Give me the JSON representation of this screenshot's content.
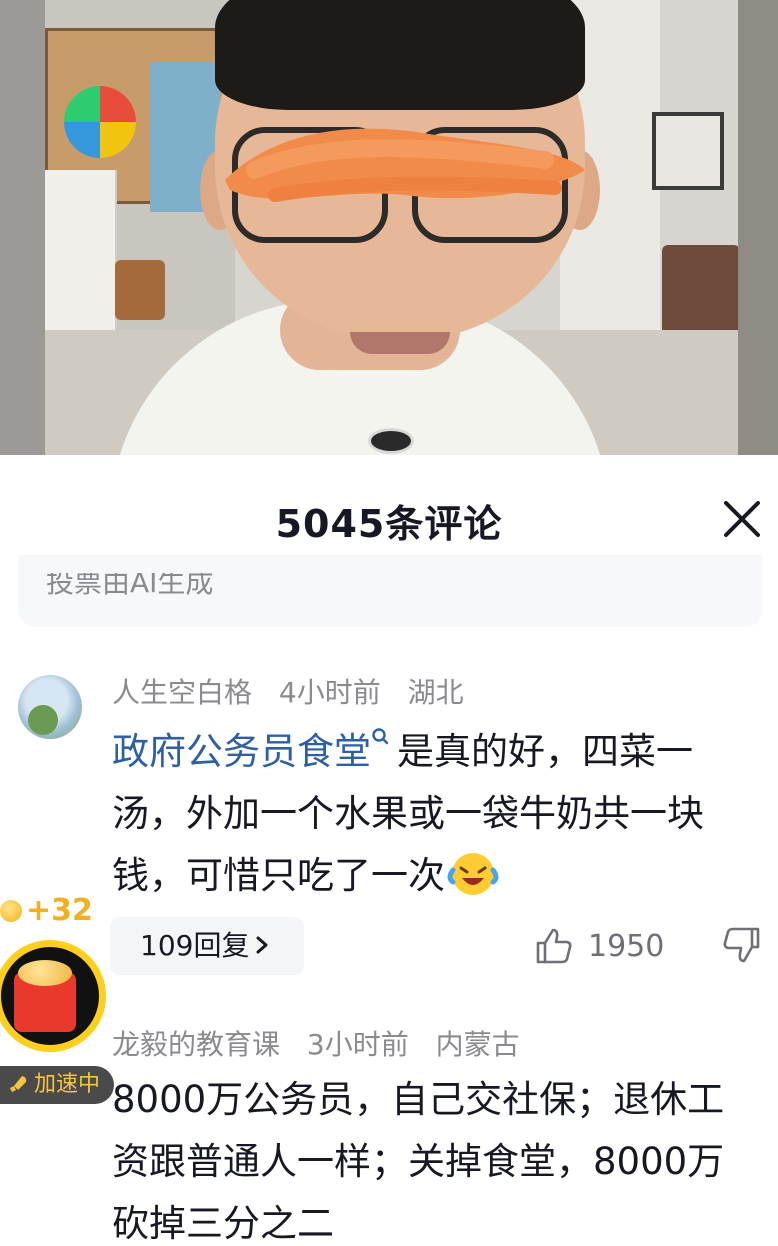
{
  "sheet": {
    "title": "5045条评论",
    "ai_notice": "投票由AI生成"
  },
  "comments": [
    {
      "username": "人生空白格",
      "time": "4小时前",
      "location": "湖北",
      "link_text": "政府公务员食堂",
      "text_part": "是真的好，四菜一汤，外加一个水果或一袋牛奶共一块钱，可惜只吃了一次",
      "emoji": "laughing-crying-emoji",
      "reply_label": "109回复",
      "likes": "1950"
    },
    {
      "username": "龙毅的教育课",
      "time": "3小时前",
      "location": "内蒙古",
      "text": "8000万公务员，自己交社保；退休工资跟普通人一样；关掉食堂，8000万砍掉三分之二"
    }
  ],
  "coin_widget": {
    "bonus": "+32",
    "status": "加速中"
  },
  "colors": {
    "link": "#2e5fa3",
    "meta": "#8a8b91",
    "text": "#161823",
    "coin": "#f0b020"
  }
}
